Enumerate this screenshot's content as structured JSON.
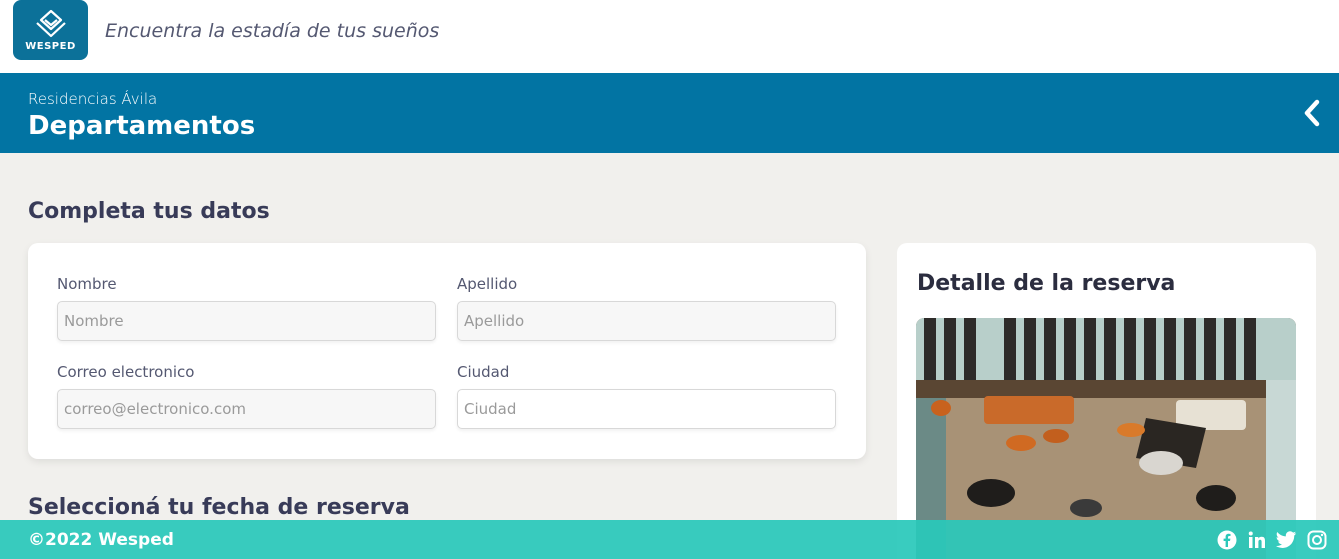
{
  "brand": {
    "name": "WESPED",
    "tagline": "Encuentra la estadía de tus sueños"
  },
  "header": {
    "subtitle": "Residencias Ávila",
    "title": "Departamentos",
    "back_icon": "chevron-left-icon"
  },
  "form": {
    "title": "Completa tus datos",
    "fields": [
      {
        "label": "Nombre",
        "placeholder": "Nombre",
        "value": ""
      },
      {
        "label": "Apellido",
        "placeholder": "Apellido",
        "value": ""
      },
      {
        "label": "Correo electronico",
        "placeholder": "correo@electronico.com",
        "value": ""
      },
      {
        "label": "Ciudad",
        "placeholder": "Ciudad",
        "value": ""
      }
    ]
  },
  "reservation": {
    "title": "Seleccioná tu fecha de reserva"
  },
  "detail": {
    "title": "Detalle de la reserva",
    "image": "lobby-photo"
  },
  "footer": {
    "copyright": "©2022 Wesped",
    "social_icons": [
      "facebook-icon",
      "linkedin-icon",
      "twitter-icon",
      "instagram-icon"
    ]
  },
  "colors": {
    "primary": "#0274a3",
    "logo_bg": "#0c7199",
    "footer": "#2ac8ba",
    "page_bg": "#f1f0ed",
    "heading": "#383b58"
  }
}
